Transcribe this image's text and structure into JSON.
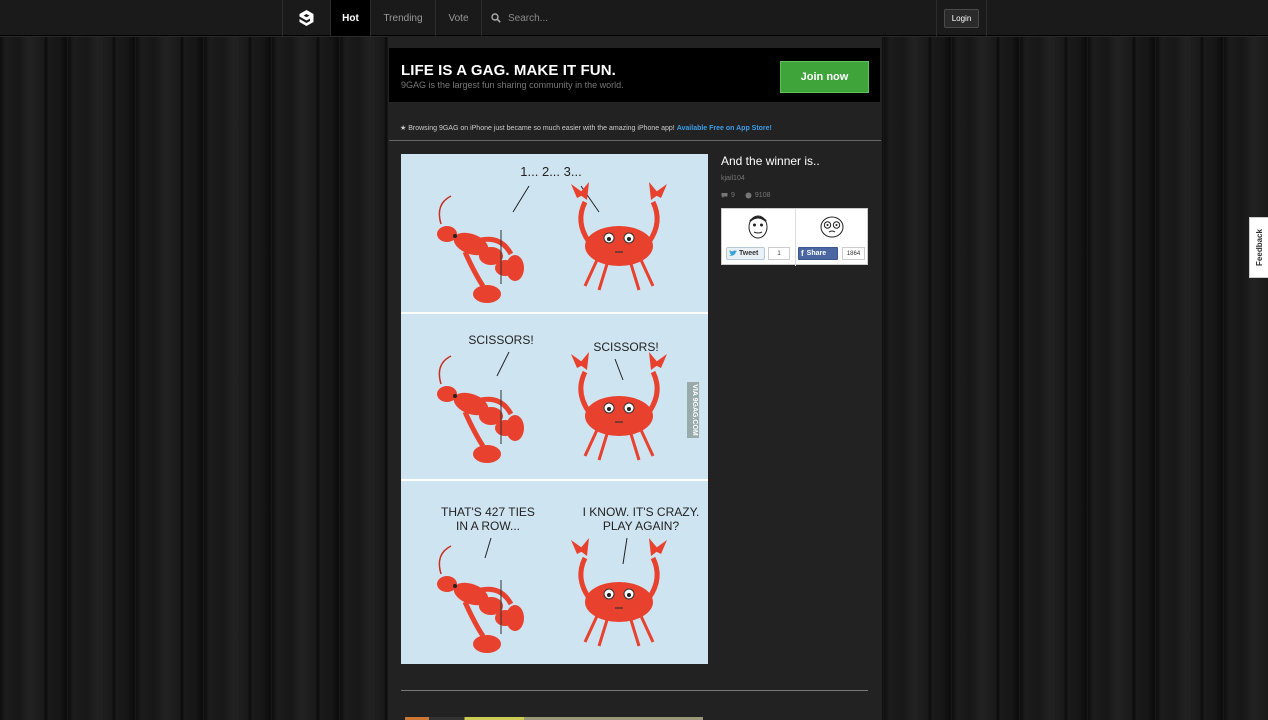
{
  "nav": {
    "tabs": [
      {
        "label": "Hot",
        "active": true
      },
      {
        "label": "Trending",
        "active": false
      },
      {
        "label": "Vote",
        "active": false
      }
    ],
    "search_placeholder": "Search...",
    "login_label": "Login"
  },
  "promo": {
    "title": "LIFE IS A GAG. MAKE IT FUN.",
    "subtitle": "9GAG is the largest fun sharing community in the world.",
    "join_label": "Join now"
  },
  "notice": {
    "text": "★ Browsing 9GAG on iPhone just became so much easier with the amazing iPhone app!",
    "link": "Available Free on App Store!"
  },
  "post": {
    "title": "And the winner is..",
    "author": "kjail104",
    "comments": "9",
    "points": "9108",
    "comic": {
      "panel1_text": "1... 2... 3...",
      "panel2_left": "SCISSORS!",
      "panel2_right": "SCISSORS!",
      "panel3_left_line1": "THAT'S 427 TIES",
      "panel3_left_line2": "IN A ROW...",
      "panel3_right_line1": "I KNOW. IT'S CRAZY.",
      "panel3_right_line2": "PLAY AGAIN?",
      "watermark": "VIA 9GAG.COM"
    },
    "share": {
      "tweet_label": "Tweet",
      "tweet_count": "1",
      "fb_label": "Share",
      "fb_count": "1864"
    }
  },
  "feedback_label": "Feedback",
  "colors": {
    "join_green": "#3fa43a",
    "link_blue": "#3b9ee8",
    "crab_red": "#e8412e",
    "comic_bg": "#cfe4f1"
  }
}
